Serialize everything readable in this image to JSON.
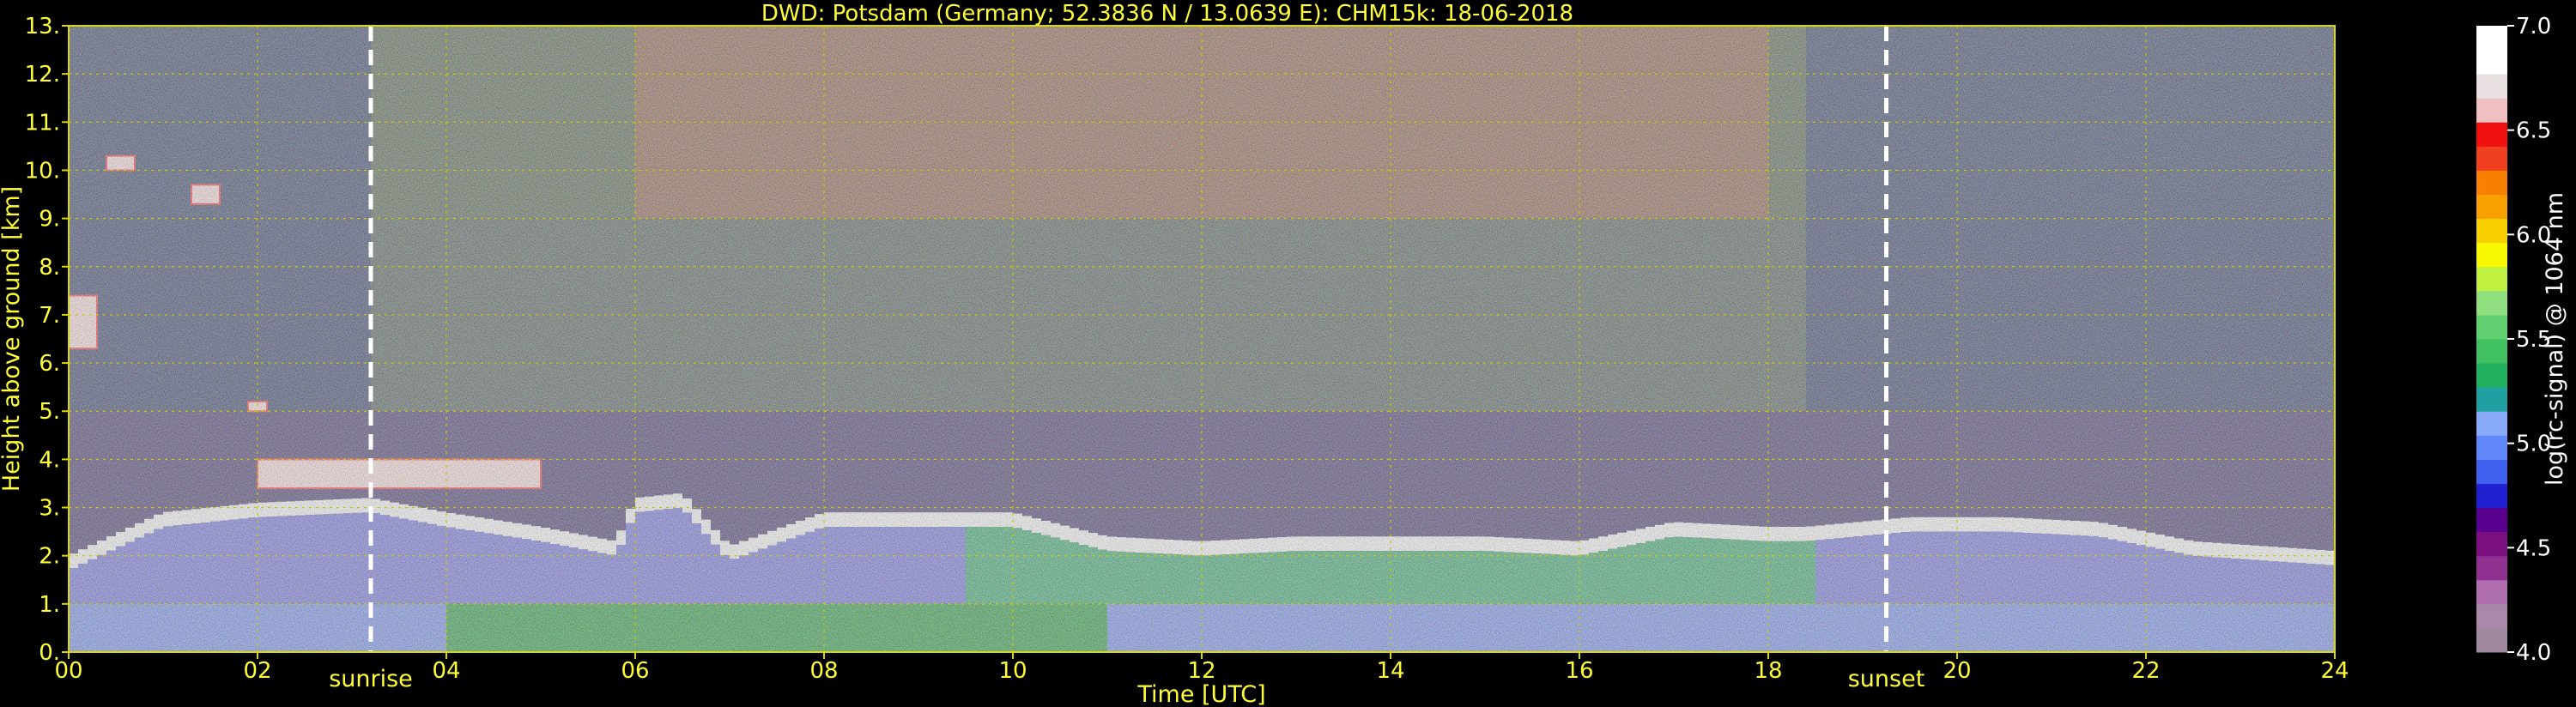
{
  "chart_data": {
    "type": "heatmap",
    "title": "DWD: Potsdam (Germany; 52.3836 N / 13.0639 E):    CHM15k: 18-06-2018",
    "xlabel": "Time [UTC]",
    "ylabel": "Height above ground [km]",
    "xlim": [
      0,
      24
    ],
    "ylim": [
      0,
      13
    ],
    "x_ticks": [
      "00",
      "02",
      "04",
      "06",
      "08",
      "10",
      "12",
      "14",
      "16",
      "18",
      "20",
      "22",
      "24"
    ],
    "x_tick_values": [
      0,
      2,
      4,
      6,
      8,
      10,
      12,
      14,
      16,
      18,
      20,
      22,
      24
    ],
    "y_ticks": [
      "0.",
      "1.",
      "2.",
      "3.",
      "4.",
      "5.",
      "6.",
      "7.",
      "8.",
      "9.",
      "10.",
      "11.",
      "12.",
      "13."
    ],
    "y_tick_values": [
      0,
      1,
      2,
      3,
      4,
      5,
      6,
      7,
      8,
      9,
      10,
      11,
      12,
      13
    ],
    "grid": true,
    "annotations": [
      {
        "text": "sunrise",
        "x": 3.2
      },
      {
        "text": "sunset",
        "x": 19.25
      }
    ],
    "boundary_layer_top": [
      [
        0.0,
        1.7
      ],
      [
        1.0,
        2.6
      ],
      [
        2.0,
        2.8
      ],
      [
        3.2,
        2.9
      ],
      [
        4.0,
        2.6
      ],
      [
        5.0,
        2.3
      ],
      [
        5.8,
        2.0
      ],
      [
        6.0,
        2.9
      ],
      [
        6.5,
        3.0
      ],
      [
        7.0,
        1.9
      ],
      [
        8.0,
        2.6
      ],
      [
        9.0,
        2.6
      ],
      [
        10.0,
        2.6
      ],
      [
        11.0,
        2.1
      ],
      [
        12.0,
        2.0
      ],
      [
        13.0,
        2.1
      ],
      [
        14.0,
        2.1
      ],
      [
        15.0,
        2.1
      ],
      [
        16.0,
        2.0
      ],
      [
        17.0,
        2.4
      ],
      [
        18.0,
        2.3
      ],
      [
        18.4,
        2.3
      ],
      [
        19.5,
        2.5
      ],
      [
        20.5,
        2.5
      ],
      [
        21.5,
        2.4
      ],
      [
        22.5,
        2.0
      ],
      [
        24.0,
        1.8
      ]
    ],
    "cloud_layers": [
      {
        "x": [
          0.0,
          0.3
        ],
        "y": [
          6.3,
          7.4
        ]
      },
      {
        "x": [
          0.4,
          0.7
        ],
        "y": [
          10.0,
          10.3
        ]
      },
      {
        "x": [
          1.3,
          1.6
        ],
        "y": [
          9.3,
          9.7
        ]
      },
      {
        "x": [
          1.9,
          2.1
        ],
        "y": [
          5.0,
          5.2
        ]
      },
      {
        "x": [
          2.0,
          5.0
        ],
        "y": [
          3.4,
          4.0
        ]
      }
    ],
    "colorbar": {
      "label": "log(rc-signal) @ 1064 nm",
      "range": [
        4.0,
        7.0
      ],
      "ticks": [
        "4.0",
        "4.5",
        "5.0",
        "5.5",
        "6.0",
        "6.5",
        "7.0"
      ],
      "tick_values": [
        4.0,
        4.5,
        5.0,
        5.5,
        6.0,
        6.5,
        7.0
      ]
    }
  }
}
